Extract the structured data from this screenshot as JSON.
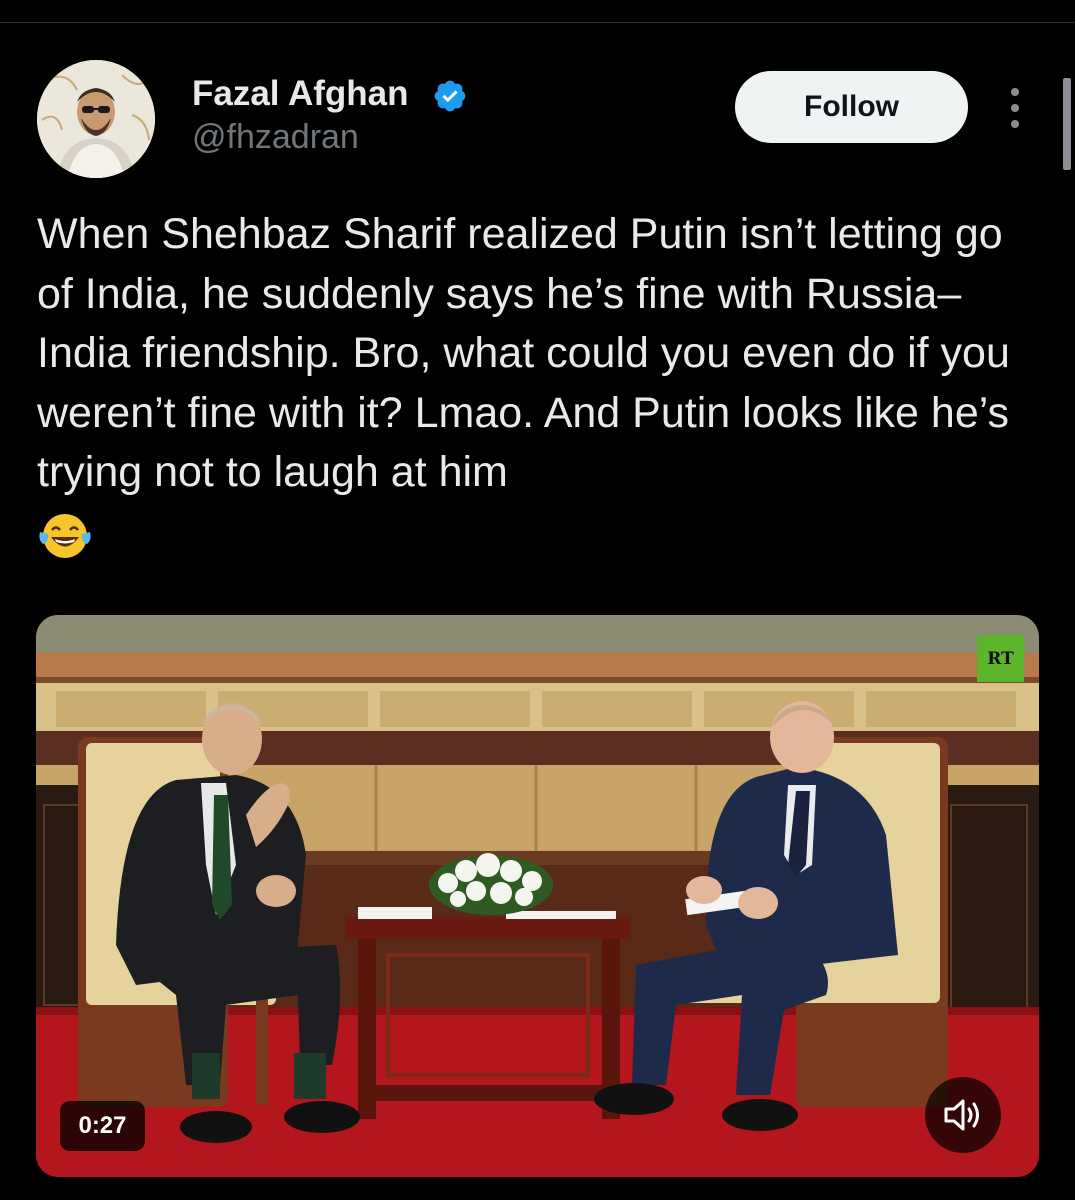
{
  "author": {
    "name": "Fazal Afghan",
    "handle": "@fhzadran",
    "verified": true,
    "avatar_icon": "profile-photo"
  },
  "actions": {
    "follow_label": "Follow",
    "more_icon": "more-vertical-icon"
  },
  "tweet": {
    "text": "When Shehbaz Sharif realized Putin isn’t letting go of India, he suddenly says he’s fine with Russia–India friendship. Bro, what could you even do if you weren’t fine with it? Lmao. And Putin looks like he’s trying not to laugh at him",
    "emoji": "😂"
  },
  "media": {
    "type": "video",
    "duration": "0:27",
    "watermark": "RT",
    "volume_icon": "volume-icon",
    "alt_subject": "meeting photo"
  },
  "colors": {
    "background": "#000000",
    "text": "#e7e9ea",
    "secondary_text": "#71767b",
    "verified_blue": "#1d9bf0",
    "follow_bg": "#eff3f4",
    "rt_green": "#5db52b",
    "carpet_red": "#b3161c"
  }
}
